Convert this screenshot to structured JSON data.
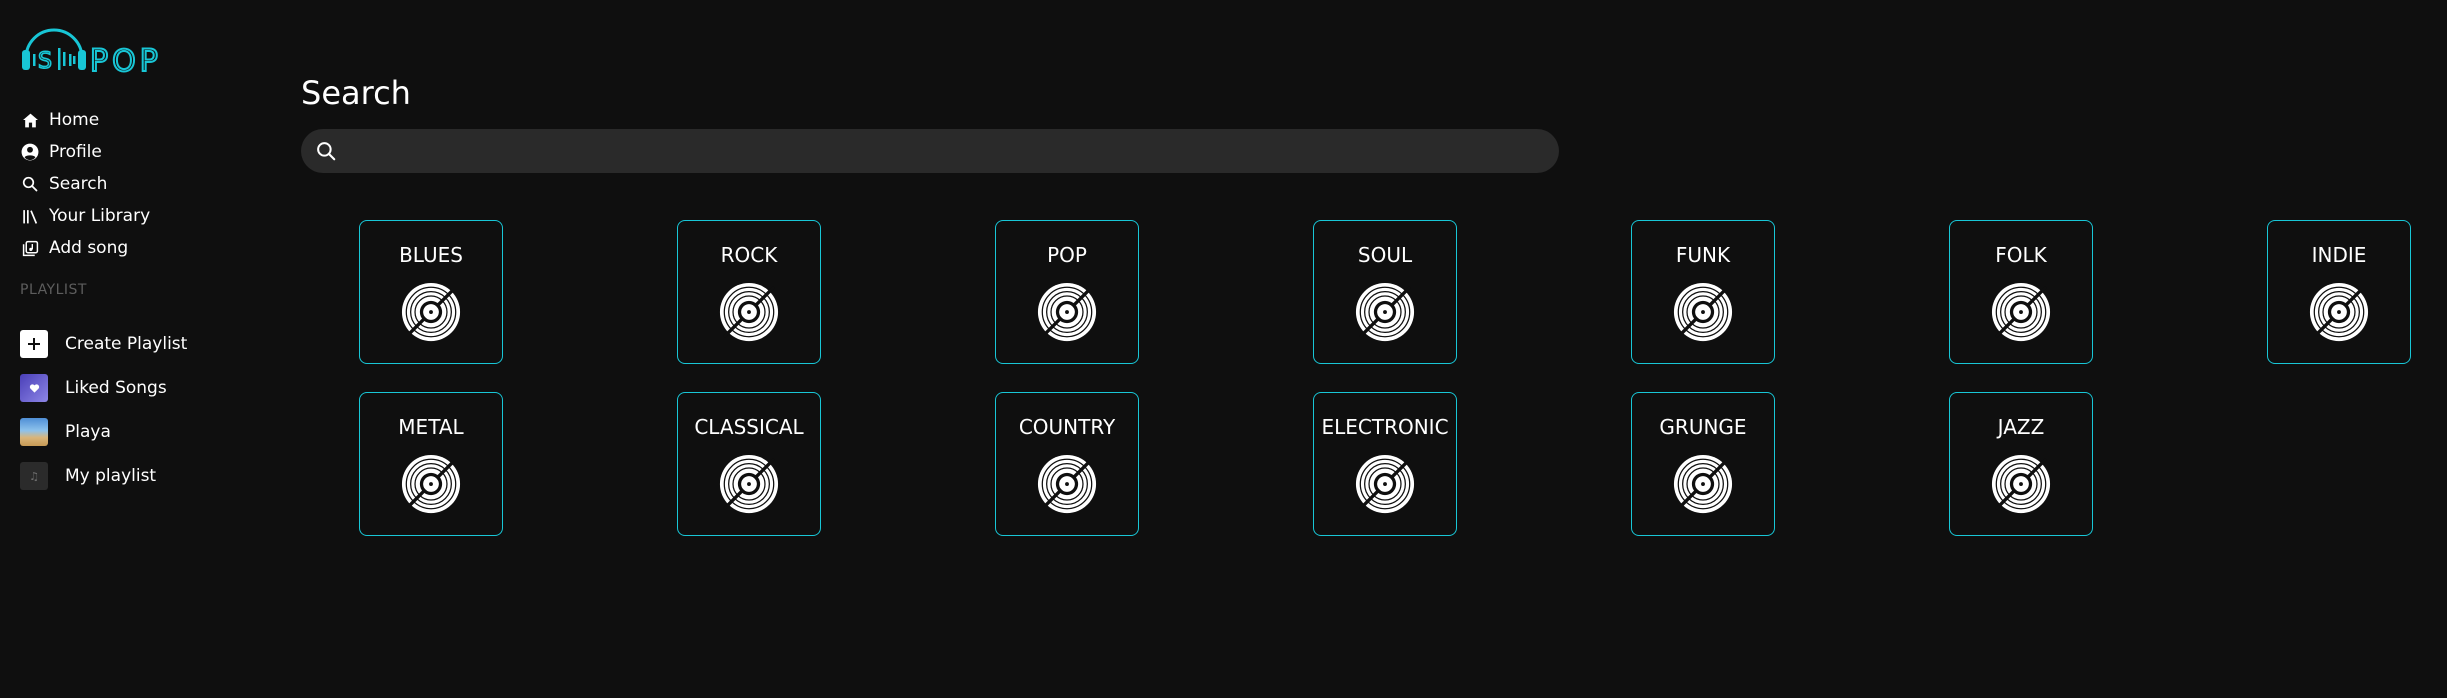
{
  "app": {
    "logo_text": "SPOP",
    "accent_color": "#18c6d6"
  },
  "sidebar": {
    "nav": [
      {
        "label": "Home",
        "icon": "home-icon"
      },
      {
        "label": "Profile",
        "icon": "profile-icon"
      },
      {
        "label": "Search",
        "icon": "search-icon"
      },
      {
        "label": "Your Library",
        "icon": "library-icon"
      },
      {
        "label": "Add song",
        "icon": "add-song-icon"
      }
    ],
    "playlist_heading": "PLAYLIST",
    "playlists": [
      {
        "label": "Create Playlist",
        "icon": "plus-icon"
      },
      {
        "label": "Liked Songs",
        "icon": "heart-icon"
      },
      {
        "label": "Playa",
        "icon": "beach-thumbnail"
      },
      {
        "label": "My playlist",
        "icon": "music-note-icon"
      }
    ]
  },
  "main": {
    "title": "Search",
    "search": {
      "value": "",
      "placeholder": ""
    },
    "genres": [
      {
        "label": "BLUES"
      },
      {
        "label": "ROCK"
      },
      {
        "label": "POP"
      },
      {
        "label": "SOUL"
      },
      {
        "label": "FUNK"
      },
      {
        "label": "FOLK"
      },
      {
        "label": "INDIE"
      },
      {
        "label": "METAL"
      },
      {
        "label": "CLASSICAL"
      },
      {
        "label": "COUNTRY"
      },
      {
        "label": "ELECTRONIC"
      },
      {
        "label": "GRUNGE"
      },
      {
        "label": "JAZZ"
      }
    ]
  }
}
